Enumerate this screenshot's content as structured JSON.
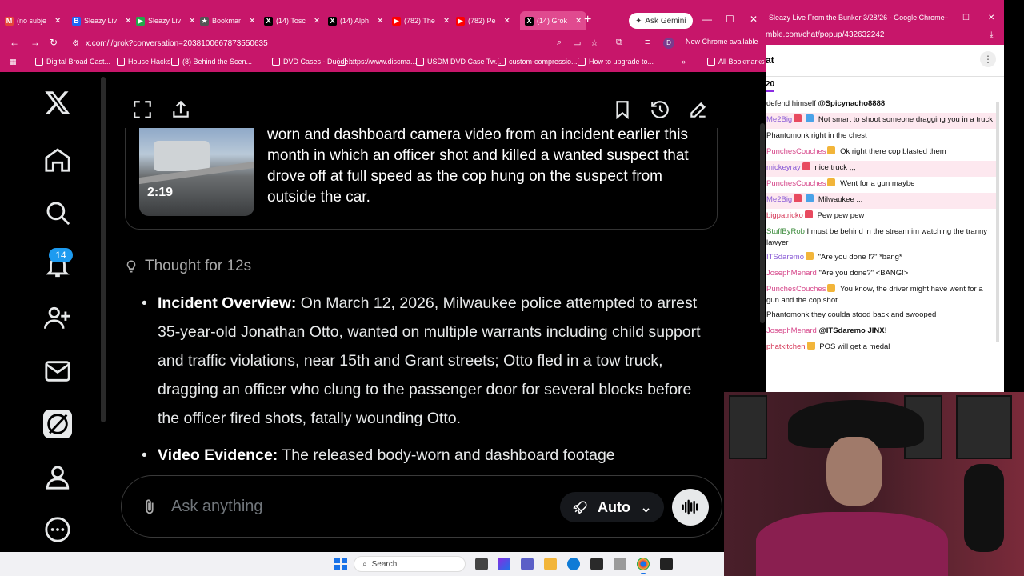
{
  "chrome": {
    "tabs": [
      {
        "label": "(no subje",
        "color": "#e5463a",
        "glyph": "M"
      },
      {
        "label": "Sleazy Liv",
        "color": "#1e66f5",
        "glyph": "B"
      },
      {
        "label": "Sleazy Liv",
        "color": "#22a84a",
        "glyph": "▶"
      },
      {
        "label": "Bookmar",
        "color": "#555555",
        "glyph": "★"
      },
      {
        "label": "(14) Tosc",
        "color": "#000000",
        "glyph": "X"
      },
      {
        "label": "(14) Alph",
        "color": "#000000",
        "glyph": "X"
      },
      {
        "label": "(782) The",
        "color": "#ff0000",
        "glyph": "▶"
      },
      {
        "label": "(782) Pe",
        "color": "#ff0000",
        "glyph": "▶"
      },
      {
        "label": "(14) Grok",
        "color": "#000000",
        "glyph": "X"
      }
    ],
    "new_tab": "+",
    "ask_gemini": "Ask Gemini",
    "url": "x.com/i/grok?conversation=2038100667873550635",
    "profile_initial": "D",
    "new_chrome": "New Chrome available",
    "bookmarks": [
      "Digital Broad Cast...",
      "House Hacks",
      "(8) Behind the Scen...",
      "DVD Cases - Duode...",
      "https://www.discma...",
      "USDM DVD Case Tw...",
      "custom-compressio...",
      "How to upgrade to..."
    ],
    "all_bookmarks": "All Bookmarks"
  },
  "x": {
    "notifications_badge": "14",
    "video": {
      "duration": "2:19",
      "description": "worn and dashboard camera video from an incident earlier this month in which an officer shot and killed a wanted suspect that drove off at full speed as the cop hung on the suspect from outside the car."
    },
    "thought": "Thought for 12s",
    "bullets": [
      {
        "title": "Incident Overview:",
        "text": " On March 12, 2026, Milwaukee police attempted to arrest 35-year-old Jonathan Otto, wanted on multiple warrants including child support and traffic violations, near 15th and Grant streets; Otto fled in a tow truck, dragging an officer who clung to the passenger door for several blocks before the officer fired shots, fatally wounding Otto."
      },
      {
        "title": "Video Evidence:",
        "text": " The released body-worn and dashboard footage"
      }
    ],
    "composer": {
      "placeholder": "Ask anything",
      "mode": "Auto"
    }
  },
  "chat": {
    "window_title": "Sleazy Live From the Bunker 3/28/26 - Google Chrome",
    "url": "mble.com/chat/popup/432632242",
    "header_title": "at",
    "count": "20",
    "messages": [
      {
        "user": "",
        "user_color": "#111111",
        "badges": [],
        "text": "defend himself ",
        "mention": "@Spicynacho8888",
        "hl": false
      },
      {
        "user": "Me2Big",
        "user_color": "#8a5cd6",
        "badges": [
          "red",
          "blue"
        ],
        "text": "Not smart to shoot someone dragging you in a truck",
        "mention": "",
        "hl": true
      },
      {
        "user": "Phantomonk",
        "user_color": "#111111",
        "badges": [],
        "text": "right in the chest",
        "mention": "",
        "hl": false
      },
      {
        "user": "PunchesCouches",
        "user_color": "#d6478a",
        "badges": [
          "gold"
        ],
        "text": "Ok right there cop blasted them",
        "mention": "",
        "hl": false
      },
      {
        "user": "mickeyray",
        "user_color": "#8a5cd6",
        "badges": [
          "red"
        ],
        "text": "nice truck ,,,",
        "mention": "",
        "hl": true
      },
      {
        "user": "PunchesCouches",
        "user_color": "#d6478a",
        "badges": [
          "gold"
        ],
        "text": "Went for a gun maybe",
        "mention": "",
        "hl": false
      },
      {
        "user": "Me2Big",
        "user_color": "#8a5cd6",
        "badges": [
          "red",
          "blue"
        ],
        "text": "Milwaukee ...",
        "mention": "",
        "hl": true
      },
      {
        "user": "bigpatricko",
        "user_color": "#d63a5a",
        "badges": [
          "red"
        ],
        "text": "Pew pew pew",
        "mention": "",
        "hl": false
      },
      {
        "user": "StuffByRob",
        "user_color": "#3a8a3a",
        "badges": [],
        "text": "I must be behind in the stream im watching the tranny lawyer",
        "mention": "",
        "hl": false
      },
      {
        "user": "ITSdaremo",
        "user_color": "#8a5cd6",
        "badges": [
          "gold"
        ],
        "text": "\"Are you done !?\" *bang*",
        "mention": "",
        "hl": false
      },
      {
        "user": "JosephMenard",
        "user_color": "#d6478a",
        "badges": [],
        "text": "\"Are you done?\" <BANG!>",
        "mention": "",
        "hl": false
      },
      {
        "user": "PunchesCouches",
        "user_color": "#d6478a",
        "badges": [
          "gold"
        ],
        "text": "You know, the driver might have went for a gun and the cop shot",
        "mention": "",
        "hl": false
      },
      {
        "user": "Phantomonk",
        "user_color": "#111111",
        "badges": [],
        "text": "they coulda stood back and swooped",
        "mention": "",
        "hl": false
      },
      {
        "user": "JosephMenard",
        "user_color": "#d6478a",
        "badges": [],
        "text": "",
        "mention": "@ITSdaremo JINX!",
        "hl": false
      },
      {
        "user": "phatkitchen",
        "user_color": "#d63a5a",
        "badges": [
          "gold"
        ],
        "text": "POS will get a medal",
        "mention": "",
        "hl": false
      }
    ]
  },
  "taskbar": {
    "search_label": "Search"
  },
  "colors": {
    "chrome_accent": "#c7166a",
    "x_blue": "#1d9bf0"
  }
}
